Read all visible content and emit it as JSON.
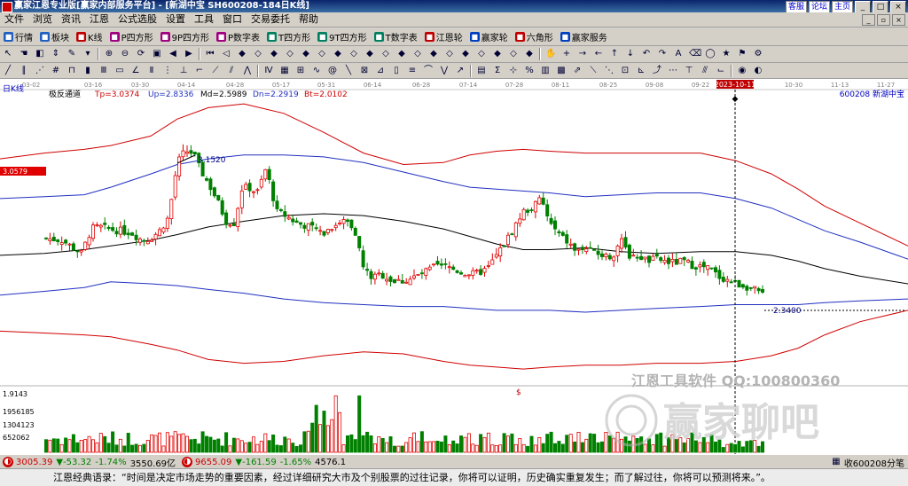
{
  "window": {
    "title": "赢家江恩专业版[赢家内部服务平台] - [新湖中宝  SH600208-184日K线]",
    "links": [
      "客服",
      "论坛",
      "主页"
    ]
  },
  "menu": [
    "文件",
    "浏览",
    "资讯",
    "江恩",
    "公式选股",
    "设置",
    "工具",
    "窗口",
    "交易委托",
    "帮助"
  ],
  "toolbar1": [
    {
      "label": "行情",
      "icon": "quote-icon",
      "color": "#2060c0"
    },
    {
      "label": "板块",
      "icon": "sector-icon",
      "color": "#2060c0"
    },
    {
      "label": "K线",
      "icon": "kline-icon",
      "color": "#c00000"
    },
    {
      "label": "P四方形",
      "icon": "square-icon",
      "color": "#a00080"
    },
    {
      "label": "9P四方形",
      "icon": "square-icon",
      "color": "#a00080"
    },
    {
      "label": "P数字表",
      "icon": "table-icon",
      "color": "#a00080"
    },
    {
      "label": "T四方形",
      "icon": "square-icon",
      "color": "#008060"
    },
    {
      "label": "9T四方形",
      "icon": "square-icon",
      "color": "#008060"
    },
    {
      "label": "T数字表",
      "icon": "table-icon",
      "color": "#008060"
    },
    {
      "label": "江恩轮",
      "icon": "wheel-icon",
      "color": "#c00000"
    },
    {
      "label": "赢家轮",
      "icon": "wheel-icon",
      "color": "#0040c0"
    },
    {
      "label": "六角形",
      "icon": "hexagon-icon",
      "color": "#c00000"
    },
    {
      "label": "赢家服务",
      "icon": "service-icon",
      "color": "#0040c0"
    }
  ],
  "chart_header": {
    "period": "日K线",
    "indicator": "极反通道",
    "tp": "Tp=3.0374",
    "up": "Up=2.8336",
    "md": "Md=2.5989",
    "dn": "Dn=2.2919",
    "bt": "Bt=2.0102",
    "stock": "600208  新湖中宝"
  },
  "cursor_date": "2023-10-11",
  "price_label": "3.0579",
  "annotations": {
    "high": "3.1520",
    "low": "2.3400"
  },
  "date_ticks": [
    "03-02",
    "03-16",
    "03-30",
    "04-14",
    "04-28",
    "05-17",
    "05-31",
    "06-14",
    "06-28",
    "07-14",
    "07-28",
    "08-11",
    "08-25",
    "09-08",
    "09-22",
    "10-30",
    "11-13",
    "11-27"
  ],
  "volume_labels": [
    "1.9143",
    "1956185",
    "1304123",
    "652062"
  ],
  "watermark": {
    "line1": "江恩工具软件  QQ:100800360",
    "line2": "赢家聊吧"
  },
  "chart_data": {
    "type": "candlestick",
    "count": 184,
    "price_range": [
      1.88,
      3.36
    ],
    "annotations": {
      "high": 3.152,
      "low": 2.34
    },
    "channel_lines": [
      {
        "color": "#d00000",
        "x": [
          0,
          50,
          95,
          125,
          170,
          200,
          235,
          275,
          320,
          365,
          410,
          455,
          500,
          530,
          560,
          590,
          620,
          660,
          700,
          740,
          790,
          830,
          870,
          900,
          930,
          970,
          1024
        ],
        "y": [
          3.06,
          3.09,
          3.11,
          3.13,
          3.18,
          3.27,
          3.33,
          3.35,
          3.3,
          3.2,
          3.09,
          3.03,
          3.04,
          3.08,
          3.1,
          3.11,
          3.1,
          3.09,
          3.09,
          3.09,
          3.09,
          3.05,
          2.98,
          2.9,
          2.81,
          2.72,
          2.6
        ]
      },
      {
        "color": "#2030c0",
        "x": [
          0,
          50,
          95,
          125,
          170,
          200,
          235,
          275,
          320,
          365,
          410,
          455,
          500,
          530,
          560,
          590,
          620,
          660,
          700,
          740,
          790,
          830,
          870,
          900,
          930,
          970,
          1024
        ],
        "y": [
          2.85,
          2.86,
          2.87,
          2.91,
          2.98,
          3.03,
          3.06,
          3.08,
          3.08,
          3.07,
          3.04,
          2.99,
          2.94,
          2.91,
          2.9,
          2.89,
          2.88,
          2.86,
          2.87,
          2.88,
          2.88,
          2.85,
          2.8,
          2.74,
          2.68,
          2.62,
          2.53
        ]
      },
      {
        "color": "#000000",
        "x": [
          0,
          50,
          95,
          125,
          170,
          200,
          235,
          275,
          320,
          365,
          410,
          455,
          500,
          530,
          560,
          590,
          620,
          660,
          700,
          740,
          790,
          830,
          870,
          900,
          930,
          970,
          1024
        ],
        "y": [
          2.55,
          2.56,
          2.58,
          2.6,
          2.63,
          2.66,
          2.7,
          2.73,
          2.76,
          2.77,
          2.76,
          2.73,
          2.69,
          2.65,
          2.61,
          2.58,
          2.58,
          2.59,
          2.57,
          2.56,
          2.57,
          2.57,
          2.55,
          2.52,
          2.48,
          2.44,
          2.4
        ]
      },
      {
        "color": "#2030c0",
        "x": [
          0,
          50,
          95,
          125,
          170,
          200,
          235,
          275,
          320,
          365,
          410,
          455,
          500,
          530,
          560,
          590,
          620,
          660,
          700,
          740,
          790,
          830,
          870,
          900,
          930,
          970,
          1024
        ],
        "y": [
          2.34,
          2.36,
          2.38,
          2.41,
          2.4,
          2.39,
          2.37,
          2.35,
          2.32,
          2.3,
          2.29,
          2.28,
          2.28,
          2.27,
          2.26,
          2.26,
          2.26,
          2.25,
          2.26,
          2.27,
          2.28,
          2.29,
          2.29,
          2.29,
          2.3,
          2.31,
          2.32
        ]
      },
      {
        "color": "#d00000",
        "x": [
          0,
          50,
          95,
          125,
          170,
          200,
          235,
          275,
          320,
          365,
          410,
          455,
          500,
          530,
          560,
          590,
          620,
          660,
          700,
          740,
          790,
          830,
          870,
          900,
          930,
          970,
          1024
        ],
        "y": [
          2.15,
          2.14,
          2.13,
          2.12,
          2.08,
          2.05,
          2.0,
          1.98,
          1.99,
          2.02,
          2.04,
          2.03,
          1.99,
          1.97,
          1.96,
          1.95,
          1.96,
          1.97,
          1.97,
          1.98,
          1.98,
          1.99,
          2.02,
          2.06,
          2.13,
          2.2,
          2.26
        ]
      }
    ],
    "close_path": {
      "x": [
        52,
        70,
        92,
        103,
        112,
        122,
        135,
        148,
        160,
        170,
        180,
        190,
        198,
        203,
        210,
        218,
        225,
        235,
        245,
        255,
        265,
        272,
        280,
        290,
        300,
        312,
        322,
        335,
        350,
        365,
        380,
        390,
        400,
        410,
        420,
        430,
        445,
        460,
        475,
        490,
        505,
        520,
        535,
        550,
        560,
        570,
        580,
        590,
        600,
        610,
        620,
        630,
        640,
        650,
        660,
        670,
        680,
        690,
        700,
        710,
        720,
        730,
        740,
        750,
        760,
        770,
        780,
        790,
        800,
        810,
        820,
        830,
        840,
        850,
        860
      ],
      "y": [
        2.64,
        2.63,
        2.56,
        2.69,
        2.7,
        2.69,
        2.68,
        2.67,
        2.63,
        2.64,
        2.68,
        2.75,
        2.98,
        3.07,
        3.1,
        3.09,
        3.01,
        2.93,
        2.84,
        2.73,
        2.72,
        2.9,
        2.91,
        2.88,
        3.01,
        2.78,
        2.76,
        2.72,
        2.7,
        2.67,
        2.72,
        2.74,
        2.69,
        2.48,
        2.43,
        2.45,
        2.41,
        2.42,
        2.45,
        2.49,
        2.49,
        2.46,
        2.45,
        2.48,
        2.55,
        2.62,
        2.7,
        2.78,
        2.8,
        2.85,
        2.72,
        2.66,
        2.62,
        2.57,
        2.59,
        2.56,
        2.55,
        2.54,
        2.63,
        2.55,
        2.55,
        2.52,
        2.53,
        2.52,
        2.51,
        2.52,
        2.5,
        2.49,
        2.48,
        2.44,
        2.42,
        2.4,
        2.39,
        2.37,
        2.34
      ]
    },
    "volume_range": [
      0,
      2600000
    ]
  },
  "status": {
    "sh": "3005.39",
    "sh_chg": "▼-53.32",
    "sh_pct": "-1.74%",
    "sh_amt": "3550.69亿",
    "sz": "9655.09",
    "sz_chg": "▼-161.59",
    "sz_pct": "-1.65%",
    "sz_amt": "4576.1",
    "right": "收600208分笔"
  },
  "quote": "江恩经典语录：“时间是决定市场走势的重要因素，经过详细研究大市及个别股票的过往记录，你将可以证明，历史确实重复发生；而了解过往，你将可以预测将来。”。"
}
